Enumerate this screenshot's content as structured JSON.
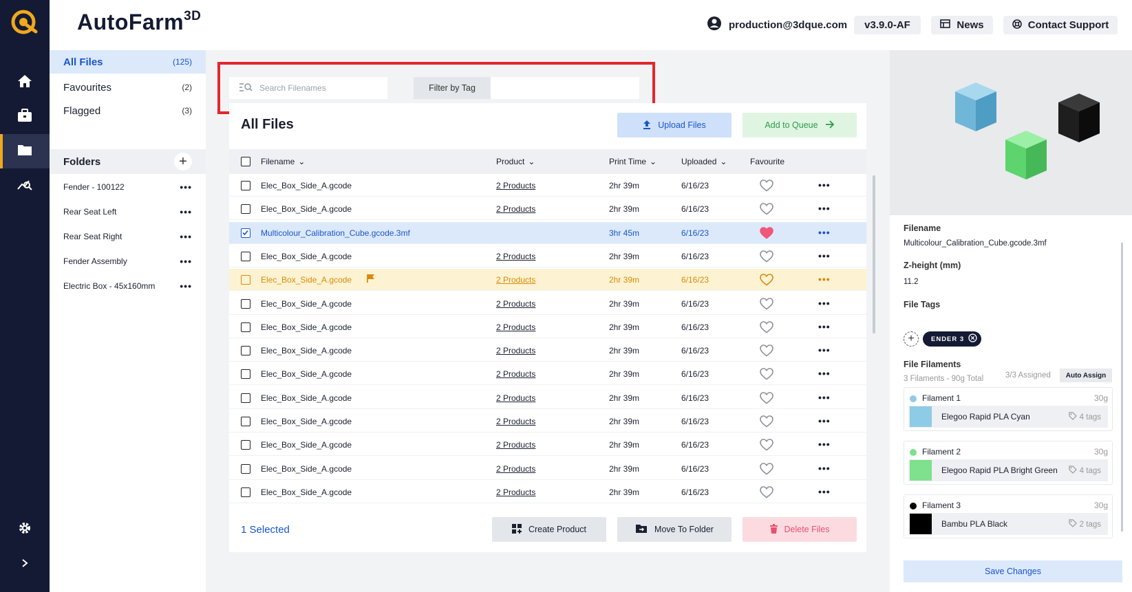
{
  "app": {
    "brand": "AutoFarm",
    "brand_sup": "3D",
    "user_email": "production@3dque.com",
    "version": "v3.9.0-AF",
    "news_label": "News",
    "support_label": "Contact Support"
  },
  "rail": {
    "items": [
      "home-icon",
      "briefcase-icon",
      "folder-icon",
      "analytics-icon"
    ],
    "active": "folder-icon",
    "bottom": [
      "settings-icon",
      "chevron-right-icon"
    ]
  },
  "sidebar": {
    "views": [
      {
        "label": "All Files",
        "count": "(125)"
      },
      {
        "label": "Favourites",
        "count": "(2)"
      },
      {
        "label": "Flagged",
        "count": "(3)"
      }
    ],
    "folders_title": "Folders",
    "folders": [
      "Fender - 100122",
      "Rear Seat Left",
      "Rear Seat Right",
      "Fender Assembly",
      "Electric Box - 45x160mm"
    ]
  },
  "search": {
    "placeholder": "Search Filenames",
    "filter_label": "Filter by Tag",
    "filter_value": ""
  },
  "files": {
    "title": "All Files",
    "upload_label": "Upload Files",
    "queue_label": "Add to Queue",
    "columns": {
      "filename": "Filename",
      "product": "Product",
      "print_time": "Print Time",
      "uploaded": "Uploaded",
      "favourite": "Favourite"
    },
    "rows": [
      {
        "filename": "Elec_Box_Side_A.gcode",
        "product": "2 Products",
        "print_time": "2hr 39m",
        "uploaded": "6/16/23"
      },
      {
        "filename": "Elec_Box_Side_A.gcode",
        "product": "2 Products",
        "print_time": "2hr 39m",
        "uploaded": "6/16/23"
      },
      {
        "filename": "Multicolour_Calibration_Cube.gcode.3mf",
        "product": "",
        "print_time": "3hr 45m",
        "uploaded": "6/16/23"
      },
      {
        "filename": "Elec_Box_Side_A.gcode",
        "product": "2 Products",
        "print_time": "2hr 39m",
        "uploaded": "6/16/23"
      },
      {
        "filename": "Elec_Box_Side_A.gcode",
        "product": "2 Products",
        "print_time": "2hr 39m",
        "uploaded": "6/16/23"
      },
      {
        "filename": "Elec_Box_Side_A.gcode",
        "product": "2 Products",
        "print_time": "2hr 39m",
        "uploaded": "6/16/23"
      },
      {
        "filename": "Elec_Box_Side_A.gcode",
        "product": "2 Products",
        "print_time": "2hr 39m",
        "uploaded": "6/16/23"
      },
      {
        "filename": "Elec_Box_Side_A.gcode",
        "product": "2 Products",
        "print_time": "2hr 39m",
        "uploaded": "6/16/23"
      },
      {
        "filename": "Elec_Box_Side_A.gcode",
        "product": "2 Products",
        "print_time": "2hr 39m",
        "uploaded": "6/16/23"
      },
      {
        "filename": "Elec_Box_Side_A.gcode",
        "product": "2 Products",
        "print_time": "2hr 39m",
        "uploaded": "6/16/23"
      },
      {
        "filename": "Elec_Box_Side_A.gcode",
        "product": "2 Products",
        "print_time": "2hr 39m",
        "uploaded": "6/16/23"
      },
      {
        "filename": "Elec_Box_Side_A.gcode",
        "product": "2 Products",
        "print_time": "2hr 39m",
        "uploaded": "6/16/23"
      },
      {
        "filename": "Elec_Box_Side_A.gcode",
        "product": "2 Products",
        "print_time": "2hr 39m",
        "uploaded": "6/16/23"
      },
      {
        "filename": "Elec_Box_Side_A.gcode",
        "product": "2 Products",
        "print_time": "2hr 39m",
        "uploaded": "6/16/23"
      }
    ],
    "selected_text": "1 Selected",
    "create_product_label": "Create Product",
    "move_folder_label": "Move To Folder",
    "delete_label": "Delete Files"
  },
  "detail": {
    "filename_label": "Filename",
    "filename": "Multicolour_Calibration_Cube.gcode.3mf",
    "zheight_label": "Z-height (mm)",
    "zheight": "11.2",
    "tags_label": "File Tags",
    "tag": "ENDER 3",
    "filaments_label": "File Filaments",
    "filaments_summary": "3 Filaments - 90g Total",
    "assigned": "3/3 Assigned",
    "auto_assign_label": "Auto Assign",
    "filaments": [
      {
        "name": "Filament 1",
        "weight": "30g",
        "material": "Elegoo Rapid PLA Cyan",
        "tags": "4 tags",
        "color": "#8ecbe6"
      },
      {
        "name": "Filament 2",
        "weight": "30g",
        "material": "Elegoo Rapid PLA Bright Green",
        "tags": "4 tags",
        "color": "#7fe08e"
      },
      {
        "name": "Filament 3",
        "weight": "30g",
        "material": "Bambu PLA Black",
        "tags": "2 tags",
        "color": "#000000"
      }
    ],
    "save_label": "Save Changes"
  },
  "colors": {
    "accent": "#1a56c6",
    "nav": "#141a33",
    "logo": "#f0a81e",
    "favourite": "#f0577a",
    "flag": "#d98a0a"
  }
}
